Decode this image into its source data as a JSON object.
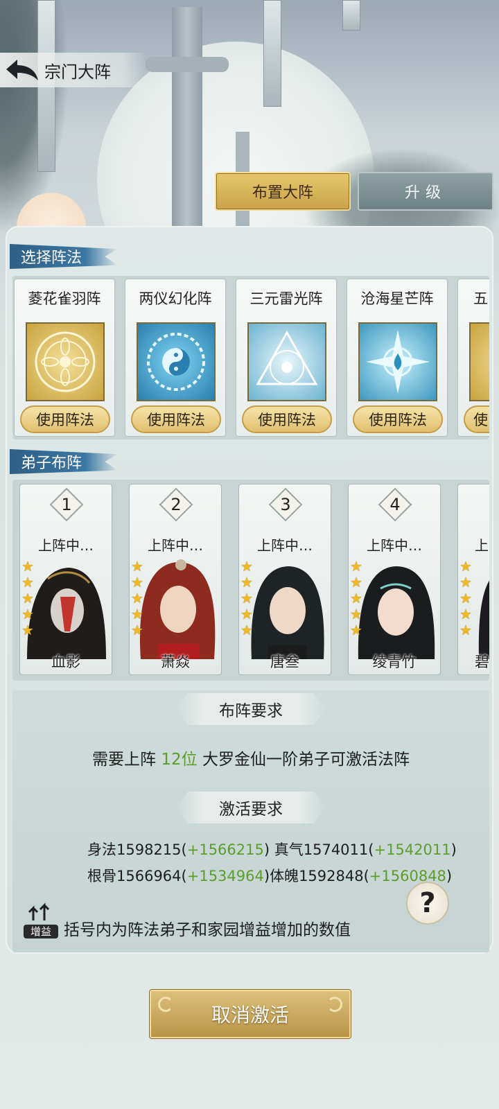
{
  "header": {
    "title": "宗门大阵"
  },
  "tabs": [
    {
      "label": "布置大阵"
    },
    {
      "label": "升级"
    }
  ],
  "sections": {
    "formations": "选择阵法",
    "disciples": "弟子布阵"
  },
  "formations": [
    {
      "name": "菱花雀羽阵",
      "button": "使用阵法",
      "theme": "gold"
    },
    {
      "name": "两仪幻化阵",
      "button": "使用阵法",
      "theme": "blue"
    },
    {
      "name": "三元雷光阵",
      "button": "使用阵法",
      "theme": "light-blue"
    },
    {
      "name": "沧海星芒阵",
      "button": "使用阵法",
      "theme": "cyan"
    },
    {
      "name": "五",
      "button": "使",
      "theme": "gold"
    }
  ],
  "disciples": [
    {
      "slot": "1",
      "status": "上阵中…",
      "name": "血影",
      "stars": 5
    },
    {
      "slot": "2",
      "status": "上阵中…",
      "name": "萧焱",
      "stars": 5
    },
    {
      "slot": "3",
      "status": "上阵中…",
      "name": "唐叁",
      "stars": 5
    },
    {
      "slot": "4",
      "status": "上阵中…",
      "name": "绫青竹",
      "stars": 5
    },
    {
      "slot": "",
      "status": "上",
      "name": "碧",
      "stars": 5
    }
  ],
  "requirements": {
    "layout_title": "布阵要求",
    "layout_text_pre": "需要上阵 ",
    "layout_count": "12位",
    "layout_text_post": " 大罗金仙一阶弟子可激活法阵",
    "activation_title": "激活要求",
    "stats": {
      "shenfa_label": "身法",
      "shenfa_value": "1598215",
      "shenfa_bonus": "+1566215",
      "zhenqi_label": "真气",
      "zhenqi_value": "1574011",
      "zhenqi_bonus": "+1542011",
      "gengu_label": "根骨",
      "gengu_value": "1566964",
      "gengu_bonus": "+1534964",
      "tipo_label": "体魄",
      "tipo_value": "1592848",
      "tipo_bonus": "+1560848"
    },
    "help_symbol": "?",
    "boost_label": "增益",
    "note": "括号内为阵法弟子和家园增益增加的数值"
  },
  "cancel_button": "取消激活",
  "colors": {
    "bonus_green": "#5a9e2c",
    "gold_button": "#d9b763",
    "ribbon_blue": "#3c77a3",
    "star": "#f0b923"
  }
}
